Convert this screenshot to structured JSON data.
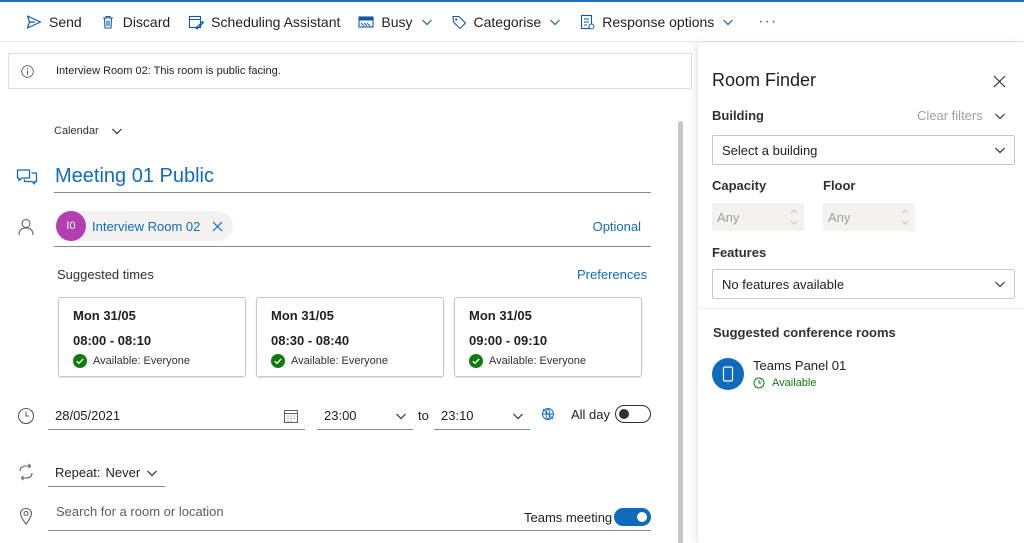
{
  "toolbar": {
    "send": "Send",
    "discard": "Discard",
    "scheduling": "Scheduling Assistant",
    "busy": "Busy",
    "categorise": "Categorise",
    "response": "Response options",
    "more": "···"
  },
  "info": {
    "message": "Interview Room 02: This room is public facing."
  },
  "calendar": {
    "label": "Calendar"
  },
  "event": {
    "title": "Meeting 01 Public"
  },
  "attendees": {
    "chip_initials": "I0",
    "chip_name": "Interview Room 02",
    "optional_label": "Optional"
  },
  "suggested": {
    "label": "Suggested times",
    "preferences_label": "Preferences",
    "cards": [
      {
        "date": "Mon 31/05",
        "range": "08:00 - 08:10",
        "status": "Available: Everyone"
      },
      {
        "date": "Mon 31/05",
        "range": "08:30 - 08:40",
        "status": "Available: Everyone"
      },
      {
        "date": "Mon 31/05",
        "range": "09:00 - 09:10",
        "status": "Available: Everyone"
      }
    ]
  },
  "datetime": {
    "date": "28/05/2021",
    "start": "23:00",
    "to_label": "to",
    "end": "23:10",
    "all_day_label": "All day",
    "all_day_on": false
  },
  "repeat": {
    "label": "Repeat:",
    "value": "Never"
  },
  "location": {
    "placeholder": "Search for a room or location",
    "teams_label": "Teams meeting",
    "teams_on": true
  },
  "room_finder": {
    "title": "Room Finder",
    "building_label": "Building",
    "clear_filters": "Clear filters",
    "building_placeholder": "Select a building",
    "capacity_label": "Capacity",
    "floor_label": "Floor",
    "capacity_value": "Any",
    "floor_value": "Any",
    "features_label": "Features",
    "features_value": "No features available",
    "suggested_label": "Suggested conference rooms",
    "rooms": [
      {
        "name": "Teams Panel 01",
        "status": "Available"
      }
    ]
  },
  "colors": {
    "accent": "#0f6cbd",
    "available": "#107c10",
    "avatar": "#b23eaf"
  }
}
